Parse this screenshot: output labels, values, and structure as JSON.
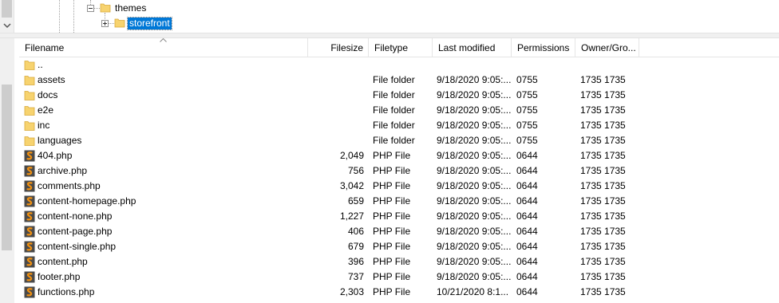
{
  "tree": {
    "nodes": [
      {
        "label": "themes",
        "icon": "folder-open-icon"
      },
      {
        "label": "storefront",
        "icon": "folder-icon",
        "selected": true
      }
    ]
  },
  "columns": {
    "filename": "Filename",
    "filesize": "Filesize",
    "filetype": "Filetype",
    "last_modified": "Last modified",
    "permissions": "Permissions",
    "owner_group": "Owner/Gro..."
  },
  "files": [
    {
      "name": "..",
      "size": "",
      "type": "",
      "modified": "",
      "perms": "",
      "owner": "",
      "icon": "folder-icon"
    },
    {
      "name": "assets",
      "size": "",
      "type": "File folder",
      "modified": "9/18/2020 9:05:...",
      "perms": "0755",
      "owner": "1735 1735",
      "icon": "folder-icon"
    },
    {
      "name": "docs",
      "size": "",
      "type": "File folder",
      "modified": "9/18/2020 9:05:...",
      "perms": "0755",
      "owner": "1735 1735",
      "icon": "folder-icon"
    },
    {
      "name": "e2e",
      "size": "",
      "type": "File folder",
      "modified": "9/18/2020 9:05:...",
      "perms": "0755",
      "owner": "1735 1735",
      "icon": "folder-icon"
    },
    {
      "name": "inc",
      "size": "",
      "type": "File folder",
      "modified": "9/18/2020 9:05:...",
      "perms": "0755",
      "owner": "1735 1735",
      "icon": "folder-icon"
    },
    {
      "name": "languages",
      "size": "",
      "type": "File folder",
      "modified": "9/18/2020 9:05:...",
      "perms": "0755",
      "owner": "1735 1735",
      "icon": "folder-icon"
    },
    {
      "name": "404.php",
      "size": "2,049",
      "type": "PHP File",
      "modified": "9/18/2020 9:05:...",
      "perms": "0644",
      "owner": "1735 1735",
      "icon": "php-file-icon"
    },
    {
      "name": "archive.php",
      "size": "756",
      "type": "PHP File",
      "modified": "9/18/2020 9:05:...",
      "perms": "0644",
      "owner": "1735 1735",
      "icon": "php-file-icon"
    },
    {
      "name": "comments.php",
      "size": "3,042",
      "type": "PHP File",
      "modified": "9/18/2020 9:05:...",
      "perms": "0644",
      "owner": "1735 1735",
      "icon": "php-file-icon"
    },
    {
      "name": "content-homepage.php",
      "size": "659",
      "type": "PHP File",
      "modified": "9/18/2020 9:05:...",
      "perms": "0644",
      "owner": "1735 1735",
      "icon": "php-file-icon"
    },
    {
      "name": "content-none.php",
      "size": "1,227",
      "type": "PHP File",
      "modified": "9/18/2020 9:05:...",
      "perms": "0644",
      "owner": "1735 1735",
      "icon": "php-file-icon"
    },
    {
      "name": "content-page.php",
      "size": "406",
      "type": "PHP File",
      "modified": "9/18/2020 9:05:...",
      "perms": "0644",
      "owner": "1735 1735",
      "icon": "php-file-icon"
    },
    {
      "name": "content-single.php",
      "size": "679",
      "type": "PHP File",
      "modified": "9/18/2020 9:05:...",
      "perms": "0644",
      "owner": "1735 1735",
      "icon": "php-file-icon"
    },
    {
      "name": "content.php",
      "size": "396",
      "type": "PHP File",
      "modified": "9/18/2020 9:05:...",
      "perms": "0644",
      "owner": "1735 1735",
      "icon": "php-file-icon"
    },
    {
      "name": "footer.php",
      "size": "737",
      "type": "PHP File",
      "modified": "9/18/2020 9:05:...",
      "perms": "0644",
      "owner": "1735 1735",
      "icon": "php-file-icon"
    },
    {
      "name": "functions.php",
      "size": "2,303",
      "type": "PHP File",
      "modified": "10/21/2020 8:1...",
      "perms": "0644",
      "owner": "1735 1735",
      "icon": "php-file-icon"
    }
  ],
  "colors": {
    "selection": "#0078d7",
    "folder": "#f7d36f",
    "php_icon_bg": "#4a4a4a",
    "php_icon_fg": "#f29111"
  }
}
